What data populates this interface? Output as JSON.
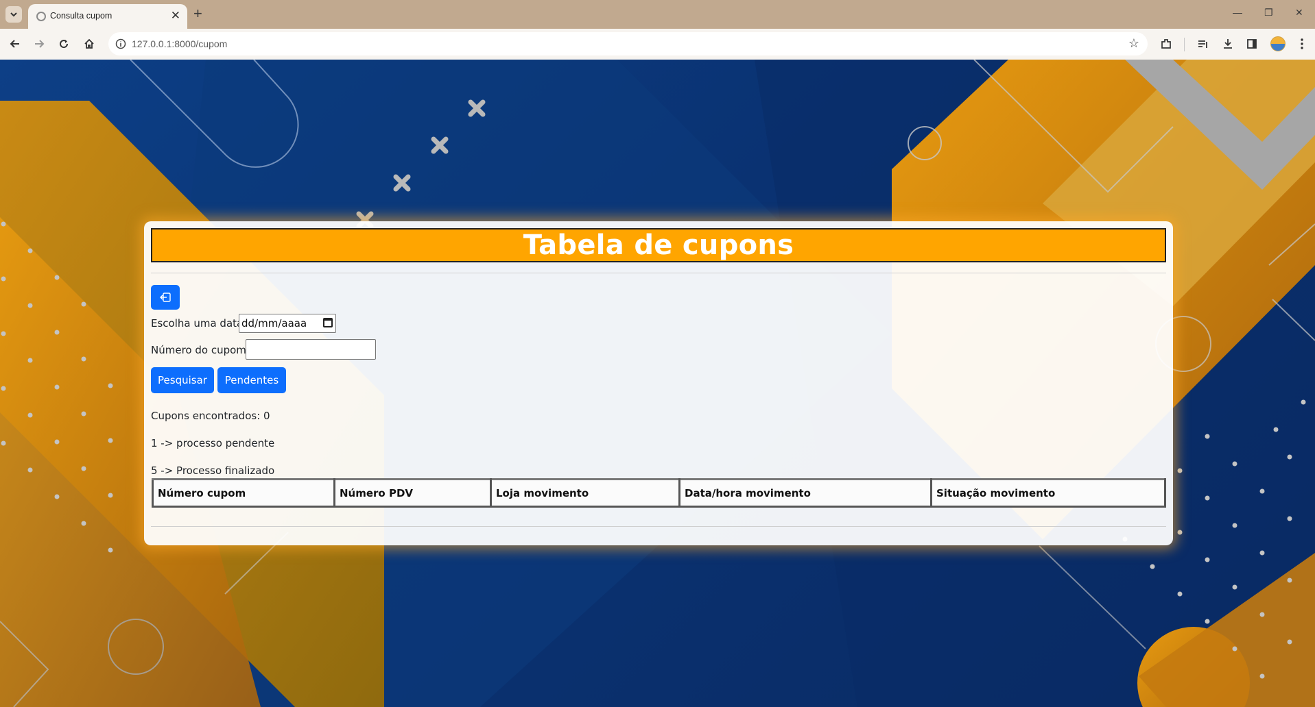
{
  "browser": {
    "tab_title": "Consulta cupom",
    "tab_close": "✕",
    "new_tab": "+",
    "url": "127.0.0.1:8000/cupom",
    "window_controls": [
      "—",
      "❐",
      "✕"
    ]
  },
  "page": {
    "title": "Tabela de cupons",
    "date_label": "Escolha uma data",
    "date_placeholder": "dd/mm/aaaa",
    "coupon_label": "Número do cupom",
    "coupon_value": "",
    "search_button": "Pesquisar",
    "pending_button": "Pendentes",
    "found_text": "Cupons encontrados: 0",
    "legend_pending": "1 -> processo pendente",
    "legend_finished": "5 -> Processo finalizado"
  },
  "table": {
    "columns": [
      "Número cupom",
      "Número PDV",
      "Loja movimento",
      "Data/hora movimento",
      "Situação movimento"
    ],
    "rows": []
  },
  "colors": {
    "title_bg": "#ffa500",
    "button_bg": "#0d6efd",
    "tabbar_bg": "#c1a98f",
    "page_bg": "#0a2f6b"
  }
}
